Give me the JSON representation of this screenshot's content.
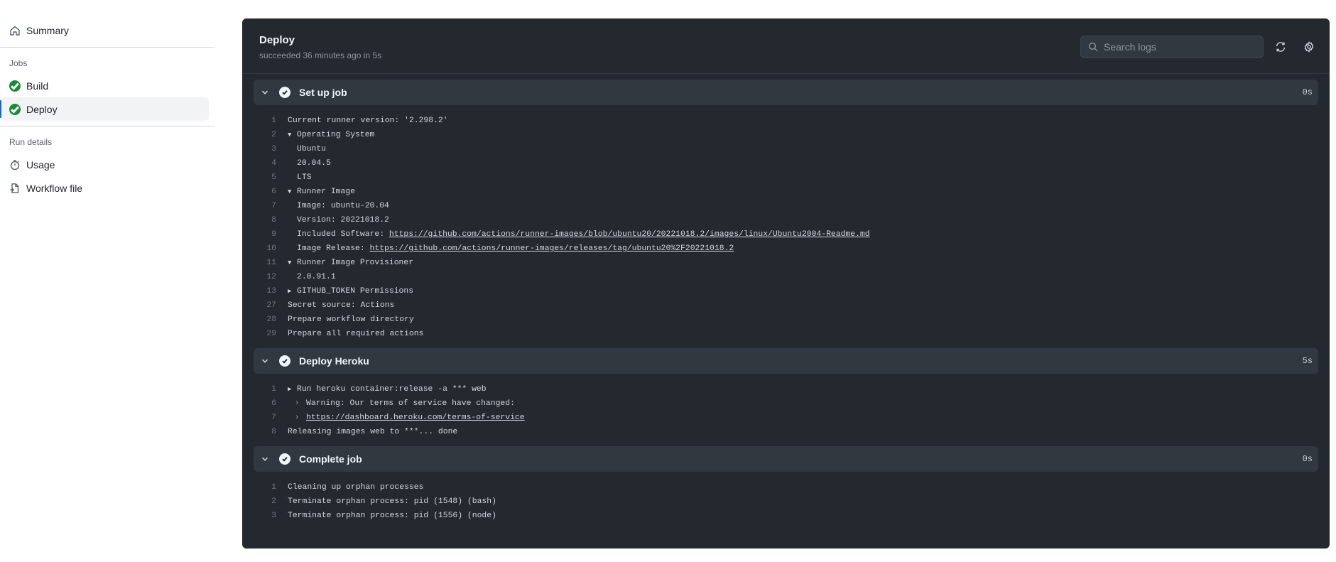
{
  "sidebar": {
    "summary": {
      "label": "Summary",
      "icon": "home-icon"
    },
    "jobs_heading": "Jobs",
    "jobs": [
      {
        "label": "Build",
        "status": "success"
      },
      {
        "label": "Deploy",
        "status": "success",
        "active": true
      }
    ],
    "run_details_heading": "Run details",
    "run_details": [
      {
        "label": "Usage",
        "icon": "stopwatch-icon"
      },
      {
        "label": "Workflow file",
        "icon": "file-icon"
      }
    ]
  },
  "panel": {
    "title": "Deploy",
    "subtitle": "succeeded 36 minutes ago in 5s",
    "search_placeholder": "Search logs"
  },
  "steps": [
    {
      "name": "Set up job",
      "duration": "0s",
      "lines": [
        {
          "n": "1",
          "text": "Current runner version: '2.298.2'"
        },
        {
          "n": "2",
          "toggle": "▼",
          "text": "Operating System"
        },
        {
          "n": "3",
          "indent": 1,
          "text": "Ubuntu"
        },
        {
          "n": "4",
          "indent": 1,
          "text": "20.04.5"
        },
        {
          "n": "5",
          "indent": 1,
          "text": "LTS"
        },
        {
          "n": "6",
          "toggle": "▼",
          "text": "Runner Image"
        },
        {
          "n": "7",
          "indent": 1,
          "text": "Image: ubuntu-20.04"
        },
        {
          "n": "8",
          "indent": 1,
          "text": "Version: 20221018.2"
        },
        {
          "n": "9",
          "indent": 1,
          "text": "Included Software: ",
          "link": "https://github.com/actions/runner-images/blob/ubuntu20/20221018.2/images/linux/Ubuntu2004-Readme.md"
        },
        {
          "n": "10",
          "indent": 1,
          "text": "Image Release: ",
          "link": "https://github.com/actions/runner-images/releases/tag/ubuntu20%2F20221018.2"
        },
        {
          "n": "11",
          "toggle": "▼",
          "text": "Runner Image Provisioner"
        },
        {
          "n": "12",
          "indent": 1,
          "text": "2.0.91.1"
        },
        {
          "n": "13",
          "toggle": "▶",
          "text": "GITHUB_TOKEN Permissions"
        },
        {
          "n": "27",
          "text": "Secret source: Actions"
        },
        {
          "n": "28",
          "text": "Prepare workflow directory"
        },
        {
          "n": "29",
          "text": "Prepare all required actions"
        }
      ]
    },
    {
      "name": "Deploy Heroku",
      "duration": "5s",
      "lines": [
        {
          "n": "1",
          "toggle": "▶",
          "text": "Run heroku container:release -a *** web"
        },
        {
          "n": "6",
          "caret": "›",
          "text": "Warning: Our terms of service have changed:"
        },
        {
          "n": "7",
          "caret": "›",
          "text": "",
          "link": "https://dashboard.heroku.com/terms-of-service"
        },
        {
          "n": "8",
          "text": "Releasing images web to ***... done"
        }
      ]
    },
    {
      "name": "Complete job",
      "duration": "0s",
      "lines": [
        {
          "n": "1",
          "text": "Cleaning up orphan processes"
        },
        {
          "n": "2",
          "text": "Terminate orphan process: pid (1548) (bash)"
        },
        {
          "n": "3",
          "text": "Terminate orphan process: pid (1556) (node)"
        }
      ]
    }
  ],
  "colors": {
    "panel_bg": "#24292f",
    "step_bar_bg": "#32383f",
    "success_green": "#1f883d",
    "active_indicator": "#0969da"
  }
}
